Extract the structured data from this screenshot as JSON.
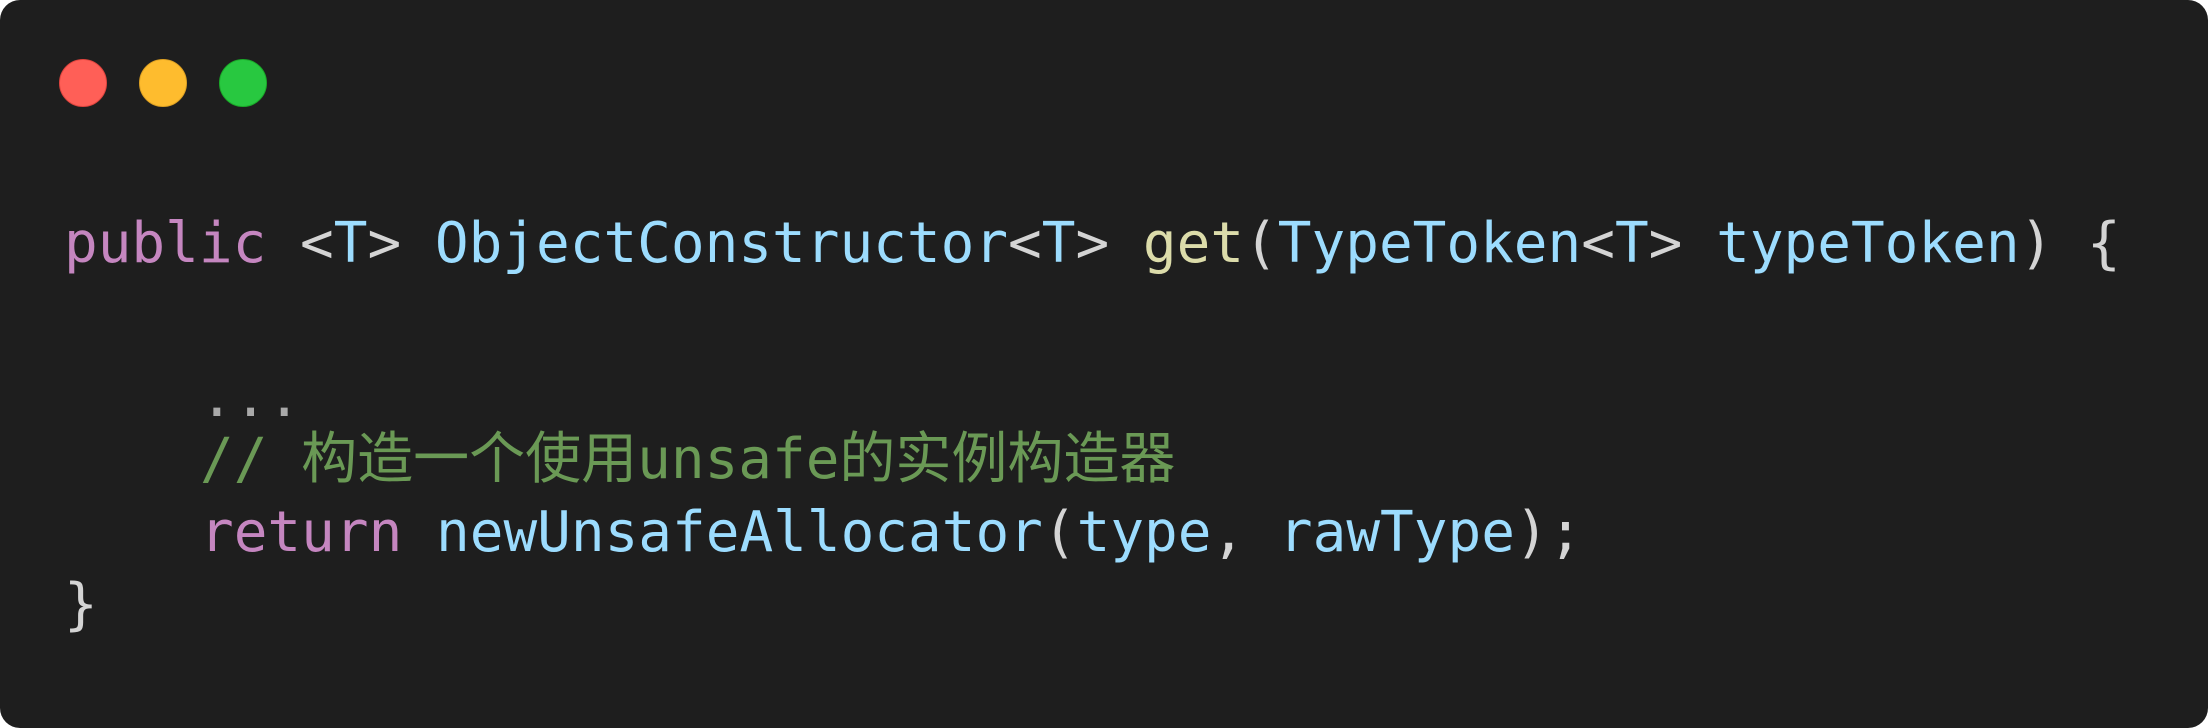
{
  "window": {
    "background": "#1e1e1e",
    "controls": [
      "close-button",
      "minimize-button",
      "zoom-button"
    ],
    "control_colors": {
      "close": "#ff5f57",
      "minimize": "#febc2e",
      "zoom": "#28c840"
    }
  },
  "code": {
    "line1": {
      "public_kw": "public",
      "space1": " ",
      "lt1": "<",
      "T1": "T",
      "gt1": ">",
      "space2": " ",
      "return_type": "ObjectConstructor",
      "lt2": "<",
      "T2": "T",
      "gt2": ">",
      "space3": " ",
      "method_name": "get",
      "paren_open": "(",
      "param_type": "TypeToken",
      "lt3": "<",
      "T3": "T",
      "gt3": ">",
      "space4": " ",
      "param_name": "typeToken",
      "paren_close": ")",
      "space5": " ",
      "brace_open": "{"
    },
    "line2": {
      "ellipsis": "..."
    },
    "line3": {
      "comment": "// 构造一个使用unsafe的实例构造器"
    },
    "line4": {
      "return_kw": "return",
      "space1": " ",
      "call_name": "newUnsafeAllocator",
      "paren_open": "(",
      "arg1": "type",
      "comma": ",",
      "space2": " ",
      "arg2": "rawType",
      "paren_close": ")",
      "semicolon": ";"
    },
    "line5": {
      "brace_close": "}"
    }
  },
  "syntax_colors": {
    "keyword": "#c586c0",
    "type": "#9cdcfe",
    "function": "#dcdcaa",
    "punctuation": "#d4d4d4",
    "comment": "#6a9955"
  }
}
